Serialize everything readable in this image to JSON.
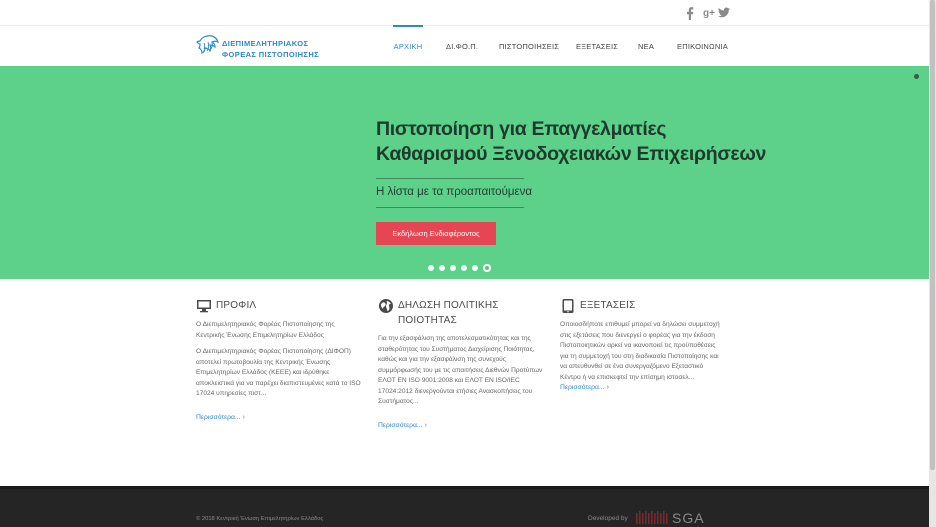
{
  "social": {
    "facebook": "f",
    "googleplus": "g+",
    "twitter_icon": "twitter-icon"
  },
  "logo": {
    "line1": "ΔΙΕΠΙΜΕΛΗΤΗΡΙΑΚΟΣ",
    "line2": "ΦΟΡΕΑΣ ΠΙΣΤΟΠΟΙΗΣΗΣ"
  },
  "nav": [
    {
      "label": "ΑΡΧΙΚΗ"
    },
    {
      "label": "ΔΙ.ΦΟ.Π."
    },
    {
      "label": "ΠΙΣΤΟΠΟΙΗΣΕΙΣ"
    },
    {
      "label": "ΕΞΕΤΑΣΕΙΣ"
    },
    {
      "label": "ΝΕΑ"
    },
    {
      "label": "ΕΠΙΚΟΙΝΩΝΙΑ"
    }
  ],
  "hero": {
    "title_line1": "Πιστοποίηση για Επαγγελματίες",
    "title_line2": "Καθαρισμού Ξενοδοχειακών Επιχειρήσεων",
    "subtitle": "Η λίστα με τα προαπαιτούμενα",
    "cta": "Εκδήλωση Ενδιαφέροντος",
    "slide_count": 6,
    "active_slide": 6,
    "bg_color": "#5dd08a",
    "cta_color": "#e64553"
  },
  "columns": [
    {
      "title": "ΠΡΟΦΙΛ",
      "icon": "monitor-icon",
      "paragraphs": [
        "Ο Διεπιμελητηριακός Φορέας Πιστοποίησης της Κεντρικής Ένωσης Επιμελητηρίων Ελλάδος",
        "Ο Διεπιμελητηριακός Φορέας Πιστοποίησης (ΔΙΦΟΠ) αποτελεί πρωτοβουλία της Κεντρικής Ένωσης Επιμελητηρίων Ελλάδος (ΚΕΕΕ) και ιδρύθηκε αποκλειστικά για να παρέχει διαπιστευμένες κατά το ISO 17024 υπηρεσίες πιστ..."
      ],
      "more": "Περισσότερα..."
    },
    {
      "title_line1": "ΔΗΛΩΣΗ ΠΟΛΙΤΙΚΗΣ",
      "title_line2": "ΠΟΙΟΤΗΤΑΣ",
      "icon": "globe-icon",
      "paragraphs": [
        "Για την εξασφάλιση της αποτελεσματικότητας και της σταθερότητας του Συστήματος Διαχείρισης Ποιότητας, καθώς και για την εξασφάλιση της συνεχούς συμμόρφωσής του με τις απαιτήσεις Διεθνών Προτύπων ΕΛΟΤ ΕΝ ISO 9001:2008 και ΕΛΟΤ ΕΝ ISO/IEC 17024:2012 διενεργούνται ετήσιες Ανασκοπήσεις του Συστήματος..."
      ],
      "more": "Περισσότερα..."
    },
    {
      "title": "ΕΞΕΤΑΣΕΙΣ",
      "icon": "tablet-icon",
      "paragraphs": [
        "Οποιοσδήποτε επιθυμεί μπορεί να δηλώσει συμμετοχή στις εξετάσεις που διενεργεί ο φορέας για την έκδοση Πιστοποιητικών αρκεί να ικανοποιεί τις προϋποθέσεις για τη συμμετοχή του στη διαδικασία Πιστοποίησης και να απευθυνθεί σε ένα συνεργαζόμενο Εξεταστικό Κέντρο ή να επισκεφτεί την  επίσημη ιστοσελ..."
      ],
      "more": "Περισσότερα..."
    }
  ],
  "footer": {
    "copyright": "© 2018 Κεντρική Ένωση Επιμελητηρίων Ελλάδος",
    "developed_by": "Developed by",
    "dev_logo_text": "SGA"
  }
}
